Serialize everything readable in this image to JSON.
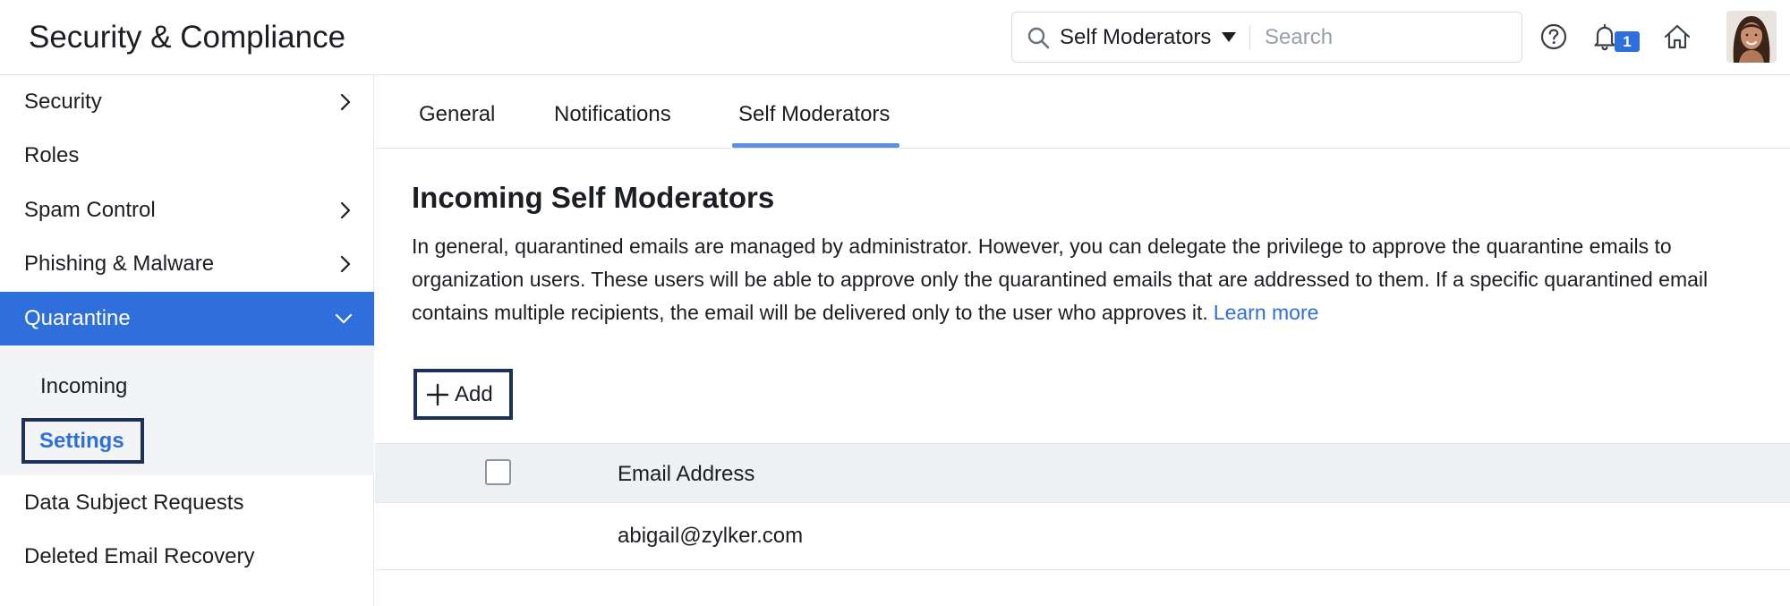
{
  "header": {
    "title": "Security & Compliance",
    "search": {
      "scope": "Self Moderators",
      "placeholder": "Search"
    },
    "notifications_count": "1",
    "icons": [
      "search-icon",
      "help-icon",
      "bell-icon",
      "home-icon",
      "avatar"
    ]
  },
  "sidebar": {
    "items": [
      {
        "label": "Security",
        "chevron": "right"
      },
      {
        "label": "Roles"
      },
      {
        "label": "Spam Control",
        "chevron": "right"
      },
      {
        "label": "Phishing & Malware",
        "chevron": "right"
      },
      {
        "label": "Quarantine",
        "chevron": "down",
        "active": true
      },
      {
        "label": "Data Subject Requests"
      },
      {
        "label": "Deleted Email Recovery"
      }
    ],
    "submenu": [
      {
        "label": "Incoming"
      },
      {
        "label": "Settings",
        "selected": true
      }
    ]
  },
  "main": {
    "tabs": [
      {
        "label": "General"
      },
      {
        "label": "Notifications"
      },
      {
        "label": "Self Moderators",
        "active": true
      }
    ],
    "section_title": "Incoming Self Moderators",
    "description": "In general, quarantined emails are managed by administrator. However, you can delegate the privilege to approve the quarantine emails to organization users. These users will be able to approve only the quarantined emails that are addressed to them. If a specific quarantined email contains multiple recipients, the email will be delivered only to the user who approves it.",
    "learn_more": "Learn more",
    "add_label": "Add",
    "table": {
      "columns": [
        "Email Address"
      ],
      "rows": [
        {
          "email": "abigail@zylker.com"
        }
      ]
    }
  },
  "colors": {
    "accent": "#2f6fdc",
    "focus_outline": "#1d3057",
    "tab_underline": "#5e8fe6",
    "table_header_bg": "#eef0f3",
    "submenu_bg": "#f3f4f6"
  }
}
